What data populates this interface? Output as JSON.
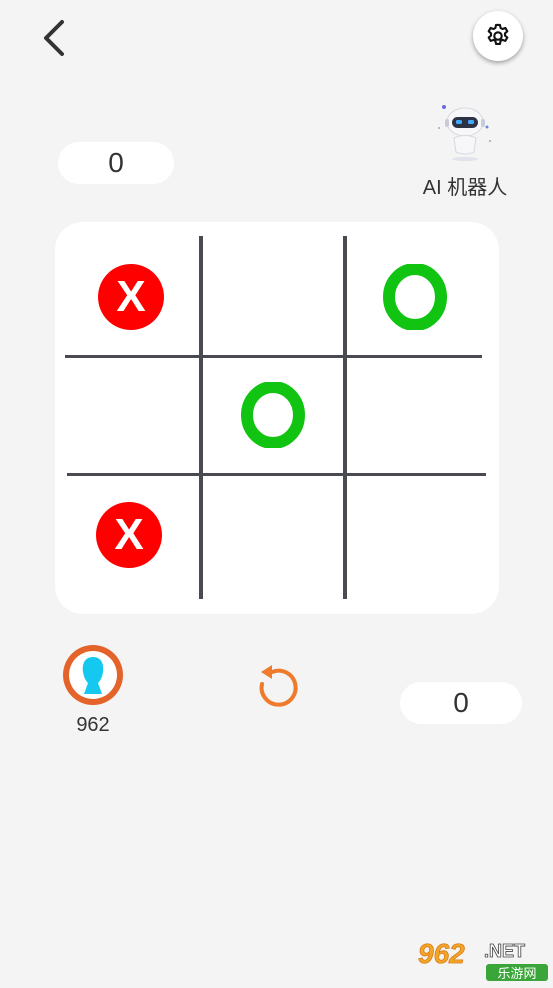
{
  "header": {
    "back_icon": "chevron-left-icon",
    "settings_icon": "gear-icon"
  },
  "opponent": {
    "name": "AI 机器人",
    "score": "0",
    "avatar_icon": "robot-icon"
  },
  "player": {
    "name": "962",
    "score": "0",
    "avatar_icon": "user-silhouette-icon"
  },
  "board": {
    "cells": [
      "X",
      "",
      "O",
      "",
      "O",
      "",
      "X",
      "",
      ""
    ],
    "x_color": "#ff0000",
    "o_color": "#11c411"
  },
  "controls": {
    "restart_icon": "restart-icon",
    "accent_color": "#f07a2b"
  },
  "watermark": {
    "brand": "962",
    "suffix": ".NET",
    "subtitle": "乐游网"
  }
}
